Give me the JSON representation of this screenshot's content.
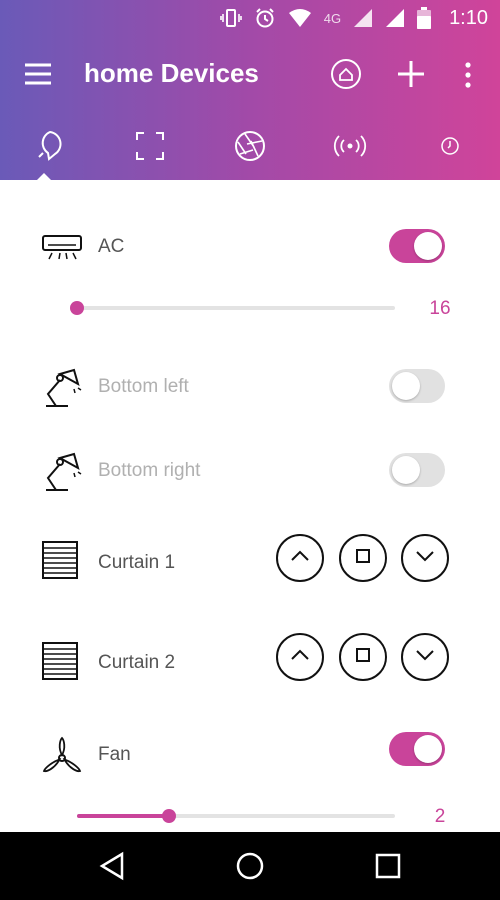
{
  "status": {
    "time": "1:10",
    "network": "4G"
  },
  "appbar": {
    "title": "home Devices"
  },
  "tabs": [
    {
      "icon": "bulb-icon"
    },
    {
      "icon": "frame-icon"
    },
    {
      "icon": "shutter-icon"
    },
    {
      "icon": "wireless-icon"
    },
    {
      "icon": "clock-icon"
    }
  ],
  "devices": [
    {
      "label": "AC",
      "icon": "air-conditioner-icon",
      "type": "toggle",
      "on": true,
      "slider_value": "16",
      "slider_level": 0
    },
    {
      "label": "Bottom left",
      "icon": "desk-lamp-icon",
      "type": "toggle",
      "on": false
    },
    {
      "label": "Bottom right",
      "icon": "desk-lamp-icon",
      "type": "toggle",
      "on": false
    },
    {
      "label": "Curtain 1",
      "icon": "curtain-icon",
      "type": "curtain"
    },
    {
      "label": "Curtain 2",
      "icon": "curtain-icon",
      "type": "curtain"
    },
    {
      "label": "Fan",
      "icon": "fan-icon",
      "type": "toggle",
      "on": true,
      "slider_value": "2",
      "slider_level": 0.29
    }
  ],
  "colors": {
    "accent": "#c9449a",
    "header_start": "#6a5ab8",
    "header_end": "#d0449a"
  }
}
